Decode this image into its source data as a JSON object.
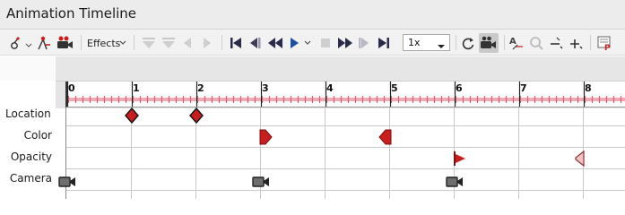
{
  "window": {
    "title": "Animation Timeline"
  },
  "toolbar": {
    "effects_label": "Effects",
    "speed_value": "1x",
    "icons": [
      "add-keyframe-icon",
      "delete-keyframe-icon",
      "camera-record-icon",
      "filter-down-icon",
      "filter-up-icon",
      "previous-icon",
      "next-icon",
      "first-frame-icon",
      "previous-frame-icon",
      "rewind-icon",
      "play-icon",
      "stop-icon",
      "fast-forward-icon",
      "next-frame-icon",
      "last-frame-icon",
      "loop-icon",
      "camera-follow-icon",
      "zoom-text-icon",
      "zoom-fit-icon",
      "zoom-out-icon",
      "zoom-in-icon",
      "settings-icon"
    ]
  },
  "ruler": {
    "ticks": [
      "0",
      "1",
      "2",
      "3",
      "4",
      "5",
      "6",
      "7",
      "8"
    ]
  },
  "tracks": [
    {
      "name": "Location",
      "keyframes": [
        {
          "time": 1,
          "shape": "diamond"
        },
        {
          "time": 2,
          "shape": "diamond"
        }
      ]
    },
    {
      "name": "Color",
      "keyframes": [
        {
          "time": 3,
          "shape": "right-arrow"
        },
        {
          "time": 5,
          "shape": "left-arrow"
        }
      ]
    },
    {
      "name": "Opacity",
      "keyframes": [
        {
          "time": 6,
          "shape": "right-flag"
        },
        {
          "time": 8,
          "shape": "left-flag"
        }
      ]
    },
    {
      "name": "Camera",
      "keyframes": [
        {
          "time": 0,
          "shape": "camera"
        },
        {
          "time": 3,
          "shape": "camera"
        },
        {
          "time": 6,
          "shape": "camera"
        }
      ]
    }
  ],
  "colors": {
    "keyframe_red": "#c81e1e",
    "ruler_pink": "#e05c73",
    "camera_gray": "#6e6e6e"
  }
}
